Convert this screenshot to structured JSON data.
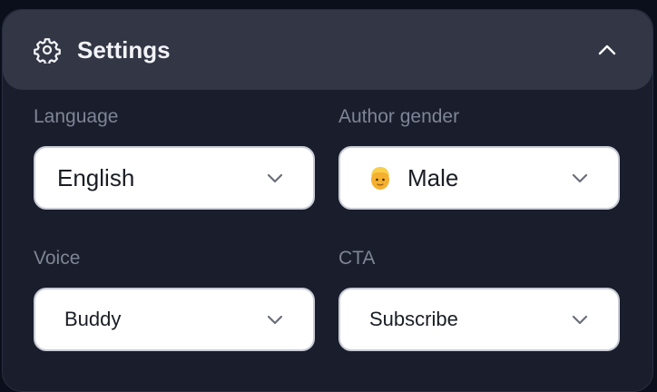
{
  "settings": {
    "title": "Settings",
    "icons": {
      "header": "gear-icon",
      "collapse": "chevron-up-icon",
      "dropdown": "chevron-down-icon"
    },
    "fields": {
      "language": {
        "label": "Language",
        "value": "English"
      },
      "author_gender": {
        "label": "Author gender",
        "value": "Male",
        "emoji": "person-blond-hair-emoji"
      },
      "voice": {
        "label": "Voice",
        "value": "Buddy"
      },
      "cta": {
        "label": "CTA",
        "value": "Subscribe"
      }
    }
  },
  "colors": {
    "page_background": "#0b0f1c",
    "panel_background": "#191d2c",
    "header_background": "#323645",
    "label_text": "#7f8596",
    "select_background": "#ffffff"
  }
}
